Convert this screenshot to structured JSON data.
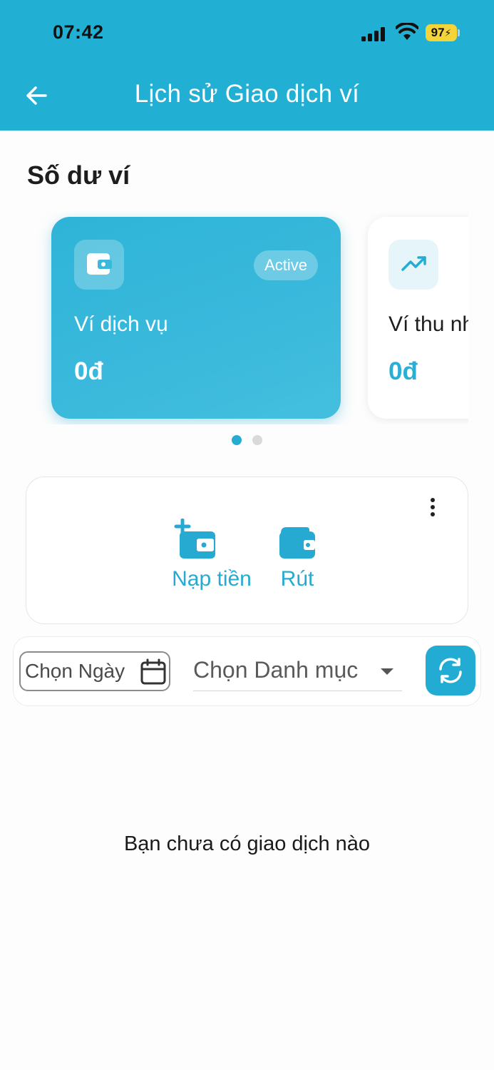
{
  "status_bar": {
    "time": "07:42",
    "battery": "97"
  },
  "header": {
    "title": "Lịch sử Giao dịch ví"
  },
  "balance_section": {
    "title": "Số dư ví"
  },
  "wallets": [
    {
      "name": "Ví dịch vụ",
      "amount": "0đ",
      "badge": "Active",
      "icon": "wallet-icon"
    },
    {
      "name": "Ví thu nh",
      "amount": "0đ",
      "icon": "trending-up-icon"
    }
  ],
  "carousel": {
    "active_index": 0,
    "count": 2
  },
  "actions": {
    "deposit_label": "Nạp tiền",
    "withdraw_label": "Rút"
  },
  "filters": {
    "date_label": "Chọn Ngày",
    "category_label": "Chọn Danh mục"
  },
  "empty_state": {
    "message": "Bạn chưa có giao dịch nào"
  },
  "colors": {
    "primary": "#21afd3",
    "text": "#1a1a1a",
    "inactive_dot": "#d9d9d9"
  }
}
